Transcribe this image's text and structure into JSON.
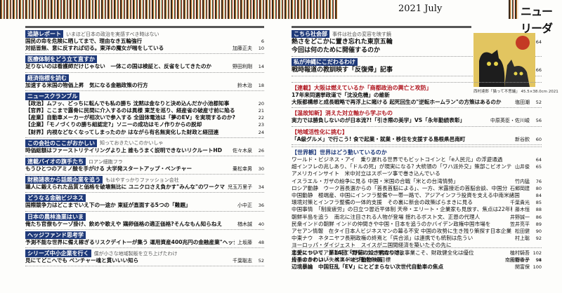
{
  "header": {
    "date": "2021 July",
    "magazine": "ニューリーダー"
  },
  "left": [
    {
      "tag": "追跡レポート",
      "sub": "いまほど日本の政治を実感すべき時はない",
      "rows": [
        {
          "t": "国民の命を危険に晒してまで、理由なき五輪強行",
          "a": "",
          "p": "6"
        },
        {
          "t": "対話皆無、意に反すれば切る。東洋の魔女が喘をしている",
          "a": "加藤正夫",
          "p": "10"
        }
      ]
    },
    {
      "tag": "医療体制をどう立て直すか",
      "sub": "",
      "rows": [
        {
          "t": "足りないのは看護師だけじゃない　一体この国は検証と、反省をしてきたのか",
          "a": "野田利剛",
          "p": "14"
        }
      ]
    },
    {
      "tag": "経済指標を読む",
      "sub": "",
      "rows": [
        {
          "t": "加速する米国の物価上昇　気になる金融政策の行方",
          "a": "鈴木治",
          "p": "18"
        }
      ]
    },
    {
      "tag": "ニュースクランブル",
      "sub": "",
      "rows": [
        {
          "t": "【政治】ムフッ、どっちに転んでも私の勝ち 沈黙は金なりと決め込んだか小池都知事",
          "a": "",
          "p": "20"
        },
        {
          "t": "【官界】ここまで露骨に民間に介入するのは異様 東芝を巡り、経産省の破産寸前に陥る",
          "a": "",
          "p": "21"
        },
        {
          "t": "【産業】自動車メーカーが相次いで参入する 全固体電池は「夢のEV」を実現するのか?",
          "a": "",
          "p": "22"
        },
        {
          "t": "【企業】「モノづくりの勝ち組認定?」ソニーの成功はモノ作りからの脱却",
          "a": "",
          "p": "23"
        },
        {
          "t": "【財界】内視などなくなってしまったのか はながら有名無実化した財政と経団連",
          "a": "",
          "p": "24"
        }
      ]
    },
    {
      "tag": "この会社のここがおかしい",
      "sub": "知っておきたいこのかいしゃ",
      "rows": [
        {
          "t": "時価総額はファーストリテイリングより上 誰もうまく説明できないリクルートHD",
          "a": "佐々木泉",
          "p": "26"
        }
      ]
    },
    {
      "tag": "連載バイオの旗手たち",
      "sub": "ロアン細胞フラ",
      "rows": [
        {
          "t": "もうひとつのアミノ酸を手がける 大学発スタートアップ・ベンチャー",
          "a": "乗松幸男",
          "p": "30"
        }
      ]
    },
    {
      "tag": "財務諸表から話題企業を追う",
      "sub": "もはやすっかりファッション会社",
      "rows": [
        {
          "t": "職人に鍛えられた品質と価格を破壊無比に ユニクロさえ負かす\"みんな\"のワークマン",
          "a": "児玉万里子",
          "p": "34"
        }
      ]
    },
    {
      "tag": "どうなる金融ビジネス",
      "sub": "",
      "rows": [
        {
          "t": "国際競争力はどこまでいえ下の一途か 東証が直面する5つの「難題」",
          "a": "小中正",
          "p": "36"
        }
      ]
    },
    {
      "tag": "日本の農林漁業はいま",
      "sub": "",
      "rows": [
        {
          "t": "俺たち官僚もケーゾ掛け、飲めや歌えや 鶏卵価格の適正価格?そんなもん知らねえ",
          "a": "楢木誠",
          "p": "40"
        }
      ]
    },
    {
      "tag": "ヘッジファンド思考学",
      "sub": "",
      "rows": [
        {
          "t": "予測不能な世界に備え稼ぎるリスクデイト一が集う 運用資産400兆円の金融産業\"ヘッジファンド\"",
          "a": "上坂藤",
          "p": "48"
        }
      ]
    },
    {
      "tag": "シリーズ中小企業を行く",
      "sub": "僕が小さな地域製販を立ち上げたわけ",
      "rows": [
        {
          "t": "見にてどこへでも ベンチャー魂と貫いいい知ら",
          "a": "千葉聡志",
          "p": "52"
        }
      ]
    }
  ],
  "right1": [
    {
      "tag": "こちら社会部",
      "sub": "事件は社会の変容を映す鏡",
      "rows": [
        {
          "t": "熱さをどこかに置き忘れた東京五輪",
          "a": "玉木研二",
          "p": "64"
        },
        {
          "t": "今回は何のために開催するのか",
          "a": "",
          "p": ""
        }
      ]
    },
    {
      "tag": "私が沖縄にこだわるわけ",
      "sub": "",
      "rows": [
        {
          "t": "戦時報道の教訓映す「反復帰」記事",
          "a": "河原仁志",
          "p": "66"
        }
      ]
    }
  ],
  "right2": [
    {
      "tag": "【連載】大阪は燃えているか「商都政治の興亡と攻防」",
      "rows": [
        {
          "t": "17年来同選挙政道で「沈没危機」の維新",
          "a": "",
          "p": ""
        },
        {
          "t": "大阪都構想と成長戦略で再浮上に賭ける 起死回生の\"逆転ホームラン\"の方策はあるのか",
          "a": "塩田潮",
          "p": "52"
        }
      ]
    },
    {
      "tag": "【温故知新】消えた対立軸から学ぶもの",
      "rows": [
        {
          "t": "実力では勝負しないのが日本流?!「引き際の美学」VS「永年勤続表彰」",
          "a": "中原英臣・佐川峻",
          "p": "56"
        }
      ]
    },
    {
      "tag": "【地域活性化に挑む】",
      "rows": [
        {
          "t": "「A級グルメ」で行こう! 食で起業・就業・移住を支援する島根県邑南町",
          "a": "新谷欽",
          "p": "60"
        }
      ]
    }
  ],
  "right3": {
    "tag": "【世界観】世界はどう動いているのか",
    "rows": [
      {
        "t": "ワールド・ビジネス・アイ　乗り遅れる世界でもビットコインと「e人民元」の浮遊通過",
        "a": "",
        "p": "64"
      },
      {
        "t": "超インフレの兆しあり、「ドルの死」が現実になる? 大統領の「ワハ派外交」策部こビオンテックが誕生",
        "a": "山井俊",
        "p": "65"
      },
      {
        "t": "アメリカインサイト　米中対立はスポーツ事で巻き込んでいる",
        "a": "",
        "p": ""
      },
      {
        "t": "イスラエル・ガザの紛争に見る 中国・米国の合戦「米との台湾情勢」",
        "a": "竹内猛",
        "p": "76"
      },
      {
        "t": "ロシア動静　ウーク首長選からの「首長首脳による」、一方、米露接近の首脳会談、中国分離作戦か",
        "a": "石郷岡建",
        "p": "80"
      },
      {
        "t": "中国動静　極端産、中国にインフラ整備や一帯一路で、アジアインフラ投資を支える中南米諸国",
        "a": "",
        "p": "84"
      },
      {
        "t": "環境対策とインフラ整備の一体的支援　その裏に新会の政策ばらまきに見る",
        "a": "千葉貴光",
        "p": "85"
      },
      {
        "t": "中国事情　「制度疲労」の日立つ習近平体制 天帝・エリート・企業家も見放す、焦点は22年秋",
        "a": "藤木恒",
        "p": "88"
      },
      {
        "t": "朝鮮半島を追う　南北に注目される人物が登場 揺れるボスト文、正恩の代理人",
        "a": "井野誠一",
        "p": "86"
      },
      {
        "t": "民衆インドの朝鮮 インドの仲間きや中国・日本を追うのかバイデン政権中国市場を",
        "a": "笠井亮平",
        "p": "89"
      },
      {
        "t": "アセアン情報　在タイ日本人ビジネスマンの幕る不安 中国の攻勢に生き残り策探す日本企業",
        "a": "松田健",
        "p": "90"
      },
      {
        "t": "中東ナウ　ネタニヤフ長期政権の終焉と「呉合派」は連携でも統制は危うい",
        "a": "村上聡",
        "p": "92"
      },
      {
        "t": "ヨーロッパ・ダイジェスト　スイスが二国間経済を築いたその先に",
        "a": "",
        "p": ""
      },
      {
        "t": "オーストラリアが教えてくれること 堅調な財政事業こそ、財政健全化は優位",
        "a": "",
        "p": ""
      },
      {
        "t": "優先するのは「失業率4%台持続」の目標",
        "a": "南田樹香子",
        "p": "94"
      }
    ]
  },
  "right4": [
    {
      "t": "恋愛について　第14回「野菊の如き君なりき」",
      "a": "植村騎吾",
      "p": "102"
    },
    {
      "t": "片手のかわいい　ベストオブ動物映画",
      "a": "片野ゆか",
      "p": "98"
    },
    {
      "t": "辺境暴論　中国狂乱「EV」にとどまらない次世代自動車の焦点",
      "a": "関富保",
      "p": "100"
    }
  ],
  "art": {
    "caption": "西村達郎「猫って不思議」 45.5×38.0cm 2021"
  }
}
